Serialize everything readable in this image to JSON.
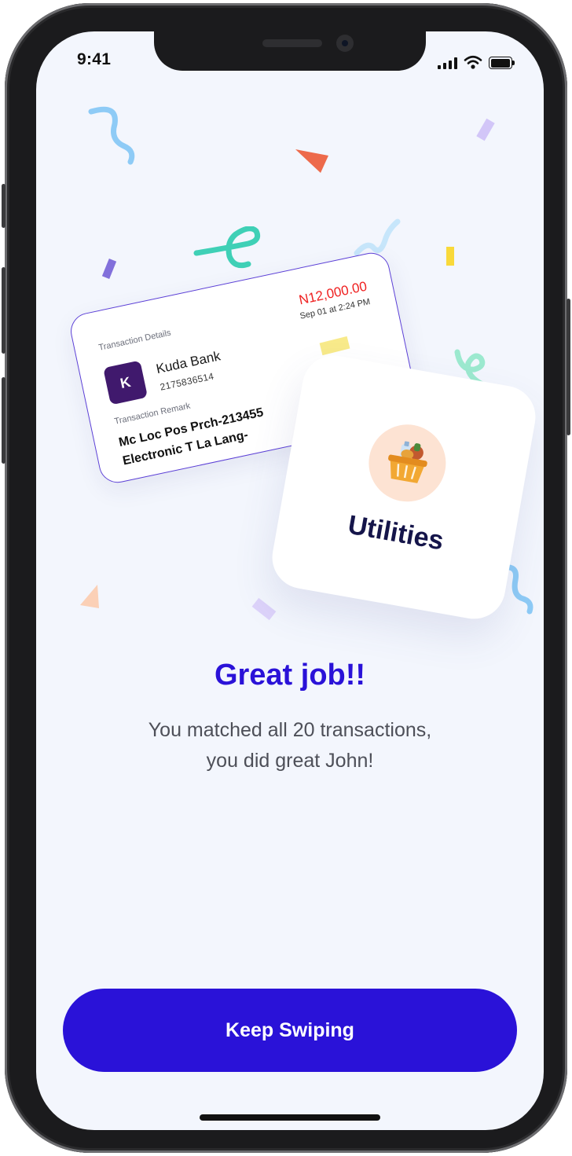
{
  "status_bar": {
    "time": "9:41"
  },
  "transaction_card": {
    "details_label": "Transaction Details",
    "bank_logo_letter": "K",
    "bank_name": "Kuda Bank",
    "account_number": "2175836514",
    "amount": "N12,000.00",
    "date": "Sep 01 at 2:24 PM",
    "remark_label": "Transaction Remark",
    "remark": "Mc Loc Pos Prch-213455\nElectronic T La Lang-"
  },
  "category_card": {
    "label": "Utilities",
    "icon": "grocery-basket-icon"
  },
  "result": {
    "title": "Great job!!",
    "message_line1": "You matched all 20 transactions,",
    "message_line2": "you did great John!"
  },
  "cta": {
    "label": "Keep Swiping"
  },
  "colors": {
    "primary": "#2a12d8",
    "amount": "#ef2020",
    "kuda_brand": "#40196d",
    "background": "#f3f6fd"
  }
}
